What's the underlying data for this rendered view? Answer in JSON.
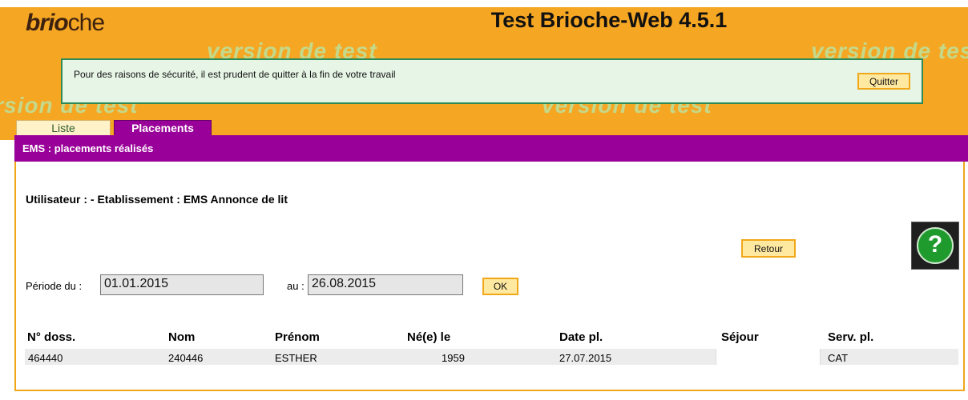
{
  "app": {
    "logo_part1": "brio",
    "logo_part2": "che",
    "title": "Test Brioche-Web 4.5.1",
    "watermark": "version de test"
  },
  "alert": {
    "message": "Pour des raisons de sécurité, il est prudent de quitter à la fin de votre travail",
    "quit_label": "Quitter"
  },
  "tabs": [
    {
      "label": "Liste",
      "active": false
    },
    {
      "label": "Placements",
      "active": true
    }
  ],
  "section": {
    "title": "EMS : placements réalisés"
  },
  "user_line": "Utilisateur : - Etablissement : EMS Annonce de lit",
  "actions": {
    "back_label": "Retour",
    "help_label": "?"
  },
  "period": {
    "from_label": "Période du :",
    "from_value": "01.01.2015",
    "to_label": "au :",
    "to_value": "26.08.2015",
    "ok_label": "OK"
  },
  "table": {
    "headers": [
      "N° doss.",
      "Nom",
      "Prénom",
      "Né(e) le",
      "Date pl.",
      "Séjour",
      "Serv. pl."
    ],
    "rows": [
      [
        "464440",
        "240446",
        "ESTHER",
        "1959",
        "27.07.2015",
        "",
        "CAT"
      ]
    ]
  },
  "colors": {
    "header_bg": "#f5a623",
    "section_bg": "#990099",
    "alert_border": "#2e8b57",
    "button_bg": "#ffe9a0"
  }
}
